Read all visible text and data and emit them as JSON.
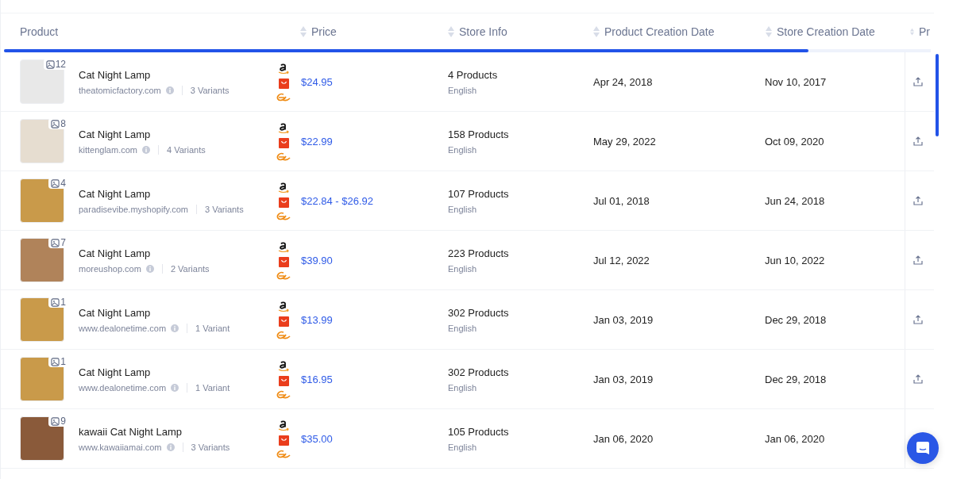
{
  "table": {
    "columns": [
      {
        "label": "Product",
        "sortable": false
      },
      {
        "label": "Price",
        "sortable": true
      },
      {
        "label": "Store Info",
        "sortable": true
      },
      {
        "label": "Product Creation Date",
        "sortable": true
      },
      {
        "label": "Store Creation Date",
        "sortable": true
      },
      {
        "label": "Pr",
        "sortable": true
      }
    ],
    "rows": [
      {
        "image_count": "12",
        "name": "Cat Night Lamp",
        "store": "theatomicfactory.com",
        "info": true,
        "variants": "3 Variants",
        "price": "$24.95",
        "products": "4 Products",
        "language": "English",
        "product_date": "Apr 24, 2018",
        "store_date": "Nov 10, 2017"
      },
      {
        "image_count": "8",
        "name": "Cat Night Lamp",
        "store": "kittenglam.com",
        "info": true,
        "variants": "4 Variants",
        "price": "$22.99",
        "products": "158 Products",
        "language": "English",
        "product_date": "May 29, 2022",
        "store_date": "Oct 09, 2020"
      },
      {
        "image_count": "4",
        "name": "Cat Night Lamp",
        "store": "paradisevibe.myshopify.com",
        "info": false,
        "variants": "3 Variants",
        "price": "$22.84 - $26.92",
        "products": "107 Products",
        "language": "English",
        "product_date": "Jul 01, 2018",
        "store_date": "Jun 24, 2018"
      },
      {
        "image_count": "7",
        "name": "Cat Night Lamp",
        "store": "moreushop.com",
        "info": true,
        "variants": "2 Variants",
        "price": "$39.90",
        "products": "223 Products",
        "language": "English",
        "product_date": "Jul 12, 2022",
        "store_date": "Jun 10, 2022"
      },
      {
        "image_count": "1",
        "name": "Cat Night Lamp",
        "store": "www.dealonetime.com",
        "info": true,
        "variants": "1 Variant",
        "price": "$13.99",
        "products": "302 Products",
        "language": "English",
        "product_date": "Jan 03, 2019",
        "store_date": "Dec 29, 2018"
      },
      {
        "image_count": "1",
        "name": "Cat Night Lamp",
        "store": "www.dealonetime.com",
        "info": true,
        "variants": "1 Variant",
        "price": "$16.95",
        "products": "302 Products",
        "language": "English",
        "product_date": "Jan 03, 2019",
        "store_date": "Dec 29, 2018"
      },
      {
        "image_count": "9",
        "name": "kawaii Cat Night Lamp",
        "store": "www.kawaiiamai.com",
        "info": true,
        "variants": "3 Variants",
        "price": "$35.00",
        "products": "105 Products",
        "language": "English",
        "product_date": "Jan 06, 2020",
        "store_date": "Jan 06, 2020"
      }
    ]
  }
}
